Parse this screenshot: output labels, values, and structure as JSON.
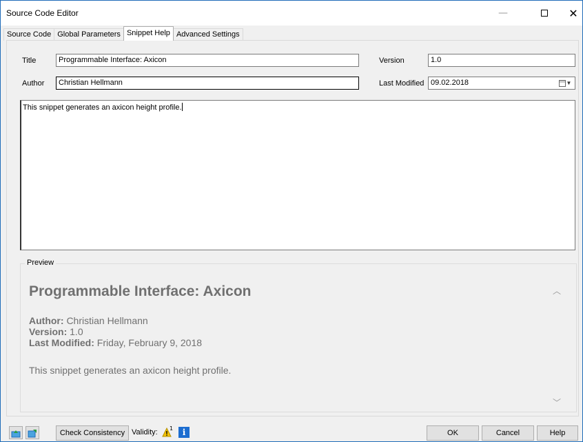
{
  "window": {
    "title": "Source Code Editor",
    "minimize": "—",
    "close": "✕"
  },
  "tabs": [
    {
      "label": "Source Code",
      "active": false
    },
    {
      "label": "Global Parameters",
      "active": false
    },
    {
      "label": "Snippet Help",
      "active": true
    },
    {
      "label": "Advanced Settings",
      "active": false
    }
  ],
  "form": {
    "title_label": "Title",
    "title_value": "Programmable Interface: Axicon",
    "author_label": "Author",
    "author_value": "Christian Hellmann",
    "version_label": "Version",
    "version_value": "1.0",
    "last_modified_label": "Last Modified",
    "last_modified_value": "09.02.2018"
  },
  "editor": {
    "text": "This snippet generates an axicon height profile."
  },
  "preview": {
    "legend": "Preview",
    "title": "Programmable Interface: Axicon",
    "author_label": "Author:",
    "author_value": "Christian Hellmann",
    "version_label": "Version:",
    "version_value": "1.0",
    "modified_label": "Last Modified:",
    "modified_value": "Friday, February 9, 2018",
    "description": "This snippet generates an axicon height profile."
  },
  "statusbar": {
    "check_consistency": "Check Consistency",
    "validity_label": "Validity:",
    "warning_count": "1",
    "ok": "OK",
    "cancel": "Cancel",
    "help": "Help"
  },
  "colors": {
    "accent": "#1c6dd0",
    "warning": "#f5c400",
    "preview_text": "#707070"
  }
}
